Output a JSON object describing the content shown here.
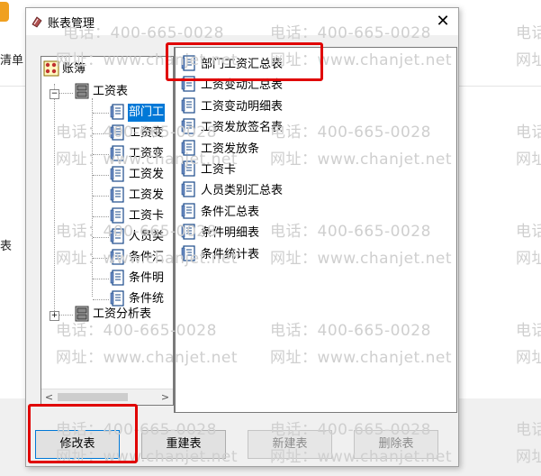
{
  "background": {
    "labels": [
      "清单",
      "表"
    ]
  },
  "watermark": {
    "phone": "电话：400-665-0028",
    "site": "网址：www.chanjet.net",
    "phone_partial": "电话",
    "site_partial": "网址"
  },
  "dialog": {
    "title": "账表管理",
    "close_label": "✕"
  },
  "tree": {
    "root": "账簿",
    "groups": [
      {
        "label": "工资表",
        "expander": "−",
        "children": [
          "部门工",
          "工资变",
          "工资变",
          "工资发",
          "工资发",
          "工资卡",
          "人员类",
          "条件汇",
          "条件明",
          "条件统"
        ]
      },
      {
        "label": "工资分析表",
        "expander": "+"
      }
    ],
    "scroll_left": "<",
    "scroll_right": ">"
  },
  "list": {
    "items": [
      "部门工资汇总表",
      "工资变动汇总表",
      "工资变动明细表",
      "工资发放签名表",
      "工资发放条",
      "工资卡",
      "人员类别汇总表",
      "条件汇总表",
      "条件明细表",
      "条件统计表"
    ]
  },
  "buttons": {
    "modify": "修改表",
    "rebuild": "重建表",
    "new": "新建表",
    "delete": "删除表"
  },
  "colors": {
    "selection": "#0078d7",
    "highlight": "#e00000"
  }
}
